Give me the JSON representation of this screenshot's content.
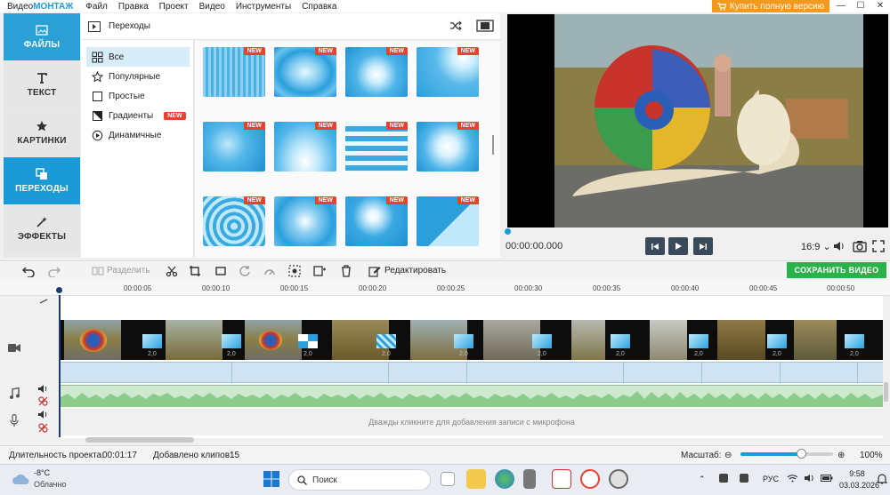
{
  "titlebar": {
    "app_name_part1": "Видео",
    "app_name_part2": "МОНТАЖ",
    "menu": [
      "Файл",
      "Правка",
      "Проект",
      "Видео",
      "Инструменты",
      "Справка"
    ],
    "buy_label": "Купить полную версию"
  },
  "nav": {
    "items": [
      {
        "label": "ФАЙЛЫ",
        "icon": "files-icon"
      },
      {
        "label": "ТЕКСТ",
        "icon": "text-icon"
      },
      {
        "label": "КАРТИНКИ",
        "icon": "star-icon"
      },
      {
        "label": "ПЕРЕХОДЫ",
        "icon": "transitions-icon"
      },
      {
        "label": "ЭФФЕКТЫ",
        "icon": "effects-wand-icon"
      }
    ],
    "active": "ПЕРЕХОДЫ"
  },
  "transitions": {
    "header": "Переходы",
    "categories": [
      {
        "label": "Все",
        "icon": "grid-icon"
      },
      {
        "label": "Популярные",
        "icon": "star-outline-icon"
      },
      {
        "label": "Простые",
        "icon": "square-icon"
      },
      {
        "label": "Градиенты",
        "icon": "gradient-icon",
        "badge": "NEW"
      },
      {
        "label": "Динамичные",
        "icon": "play-circle-icon"
      }
    ],
    "active_category": "Все",
    "new_label": "NEW"
  },
  "preview": {
    "time": "00:00:00.000",
    "ratio": "16:9"
  },
  "toolbar": {
    "split_label": "Разделить",
    "edit_label": "Редактировать",
    "save_label": "СОХРАНИТЬ ВИДЕО"
  },
  "timeline": {
    "ticks": [
      "00:00:05",
      "00:00:10",
      "00:00:15",
      "00:00:20",
      "00:00:25",
      "00:00:30",
      "00:00:35",
      "00:00:40",
      "00:00:45",
      "00:00:50"
    ],
    "transition_duration": "2,0",
    "mic_hint": "Дважды кликните для добавления записи с микрофона"
  },
  "status": {
    "duration_label": "Длительность проекта:",
    "duration_value": "00:01:17",
    "clips_label": "Добавлено клипов:",
    "clips_value": "15",
    "scale_label": "Масштаб:",
    "zoom_value": "100%"
  },
  "taskbar": {
    "temp": "-8°C",
    "weather": "Облачно",
    "search": "Поиск",
    "lang": "РУС",
    "time": "9:58",
    "date": "03.03.2026"
  }
}
